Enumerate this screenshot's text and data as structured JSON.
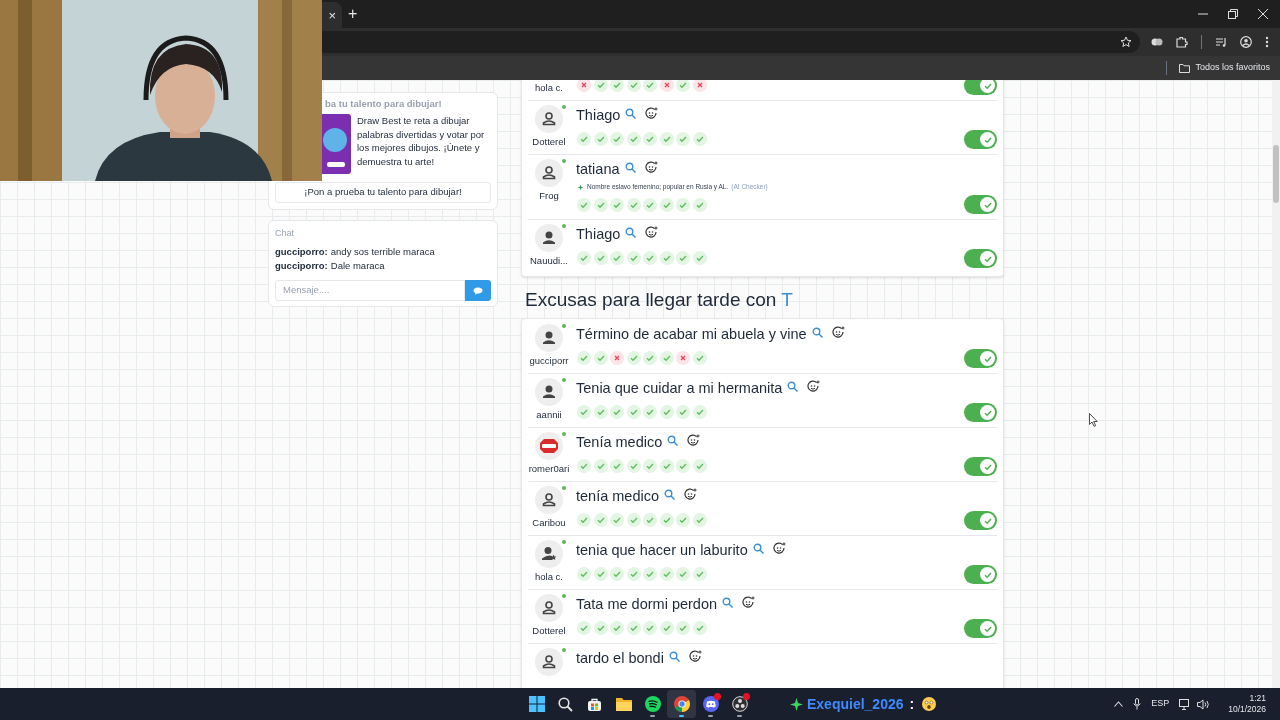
{
  "browser": {
    "tab_close": "×",
    "new_tab": "+",
    "bookmarks_label": "Todos los favoritos"
  },
  "promo": {
    "title": "ba tu talento para dibujar!",
    "text": "Draw Best te reta a dibujar palabras divertidas y votar por los mejores dibujos. ¡Únete y demuestra tu arte!",
    "button": "¡Pon a prueba tu talento para dibujar!"
  },
  "chat": {
    "title": "Chat",
    "messages": [
      {
        "user": "gucciporro:",
        "text": "andy sos terrible maraca"
      },
      {
        "user": "gucciporro:",
        "text": "Dale maraca"
      }
    ],
    "input": {
      "placeholder": "Mensaje...."
    }
  },
  "sections": [
    {
      "answers": [
        {
          "player": "hola c.",
          "marks": [
            false,
            true,
            true,
            true,
            true,
            false,
            true,
            false
          ],
          "accepted": true
        },
        {
          "player": "Dotterel",
          "avatar": {
            "kind": "outline"
          },
          "online": true,
          "answer": "Thiago",
          "marks": [
            true,
            true,
            true,
            true,
            true,
            true,
            true,
            true
          ],
          "accepted": true
        },
        {
          "player": "Frog",
          "avatar": {
            "kind": "outline"
          },
          "online": true,
          "answer": "tatiana",
          "note": "Nombre eslavo femenino; popular en Rusia y AL.",
          "note_source": "(AI Checker)",
          "marks": [
            true,
            true,
            true,
            true,
            true,
            true,
            true,
            true
          ],
          "accepted": true
        },
        {
          "player": "Nauudi...",
          "avatar": {
            "kind": "solid"
          },
          "online": true,
          "answer": "Thiago",
          "marks": [
            true,
            true,
            true,
            true,
            true,
            true,
            true,
            true
          ],
          "accepted": true
        }
      ]
    },
    {
      "title": "Excusas para llegar tarde con",
      "letter": "T",
      "answers": [
        {
          "player": "gucciporr",
          "avatar": {
            "kind": "solid"
          },
          "online": true,
          "answer": "Término de acabar mi abuela y vine",
          "marks": [
            true,
            true,
            false,
            true,
            true,
            true,
            false,
            true
          ],
          "accepted": true
        },
        {
          "player": "aannii",
          "avatar": {
            "kind": "solid"
          },
          "online": true,
          "answer": "Tenia que cuidar a mi hermanita",
          "marks": [
            true,
            true,
            true,
            true,
            true,
            true,
            true,
            true
          ],
          "accepted": true
        },
        {
          "player": "romer0ari",
          "avatar": {
            "kind": "stop"
          },
          "online": true,
          "answer": "Tenía medico",
          "marks": [
            true,
            true,
            true,
            true,
            true,
            true,
            true,
            true
          ],
          "accepted": true
        },
        {
          "player": "Caribou",
          "avatar": {
            "kind": "outline"
          },
          "online": true,
          "answer": "tenía medico",
          "marks": [
            true,
            true,
            true,
            true,
            true,
            true,
            true,
            true
          ],
          "accepted": true
        },
        {
          "player": "hola c.",
          "avatar": {
            "kind": "star"
          },
          "online": true,
          "answer": "tenia que hacer un laburito",
          "marks": [
            true,
            true,
            true,
            true,
            true,
            true,
            true,
            true
          ],
          "accepted": true
        },
        {
          "player": "Dotterel",
          "avatar": {
            "kind": "outline"
          },
          "online": true,
          "answer": "Tata me dormi perdon",
          "marks": [
            true,
            true,
            true,
            true,
            true,
            true,
            true,
            true
          ],
          "accepted": true
        },
        {
          "avatar": {
            "kind": "outline"
          },
          "online": true,
          "answer": "tardo el bondi"
        }
      ]
    }
  ],
  "taskbar": {
    "apps": [
      {
        "kind": "start",
        "running": false,
        "selected": false,
        "badge": false
      },
      {
        "kind": "search",
        "running": false,
        "selected": false,
        "badge": false
      },
      {
        "kind": "store",
        "running": false,
        "selected": false,
        "badge": false
      },
      {
        "kind": "files",
        "running": false,
        "selected": false,
        "badge": false
      },
      {
        "kind": "music",
        "running": true,
        "selected": false,
        "badge": false
      },
      {
        "kind": "browser",
        "running": true,
        "selected": true,
        "badge": false
      },
      {
        "kind": "chat",
        "running": true,
        "selected": false,
        "badge": true
      },
      {
        "kind": "recorder",
        "running": true,
        "selected": false,
        "badge": true
      }
    ],
    "stream": {
      "name": "Exequiel_2026",
      "separator": ":"
    },
    "tray": {
      "language": "ESP",
      "time": "1:21",
      "date": "10/1/2026"
    }
  }
}
